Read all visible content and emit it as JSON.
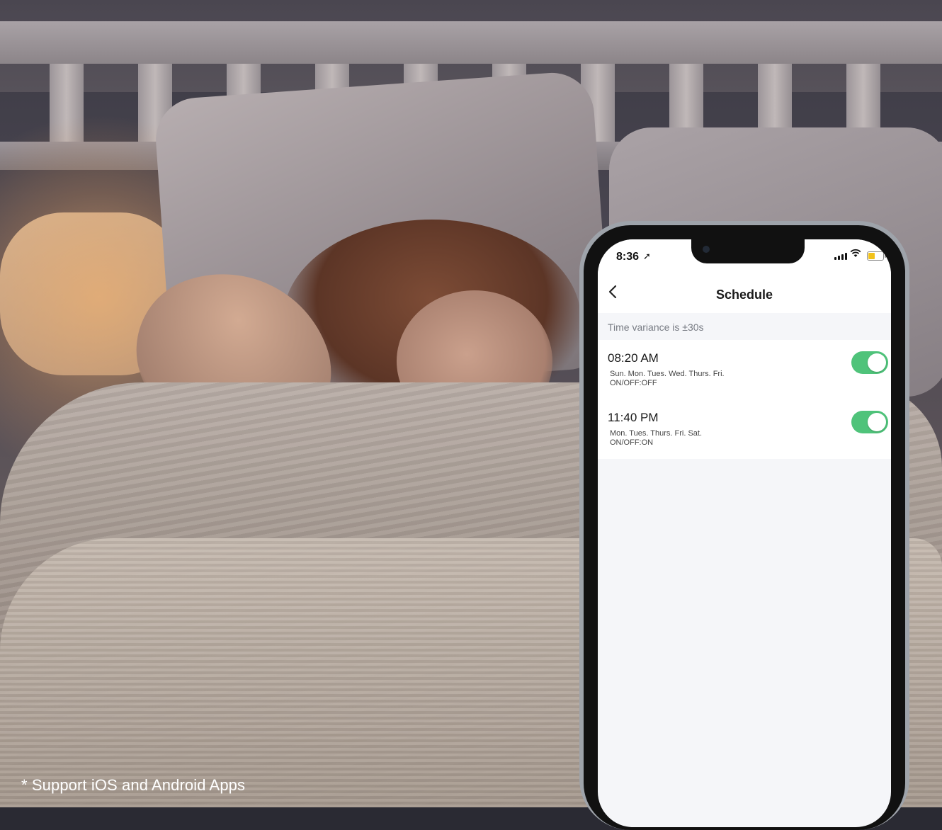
{
  "caption": "* Support iOS and Android Apps",
  "status_bar": {
    "time": "8:36"
  },
  "navbar": {
    "title": "Schedule"
  },
  "variance_text": "Time variance is  ±30s",
  "schedules": [
    {
      "time": "08:20 AM",
      "days": "Sun. Mon. Tues. Wed. Thurs. Fri.",
      "onoff": "ON/OFF:OFF",
      "enabled": true
    },
    {
      "time": "11:40 PM",
      "days": "Mon. Tues. Thurs. Fri. Sat.",
      "onoff": "ON/OFF:ON",
      "enabled": true
    }
  ],
  "colors": {
    "toggle_on": "#4fc37a",
    "battery": "#f2c21b"
  }
}
